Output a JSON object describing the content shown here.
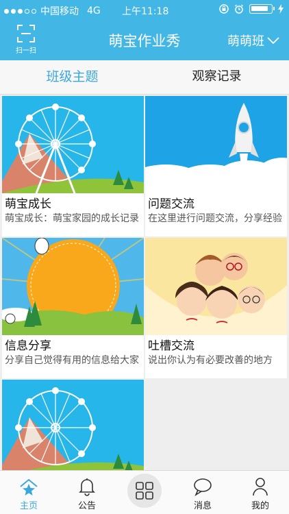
{
  "status_bar": {
    "carrier": "中国移动",
    "network": "4G",
    "time": "上午11:18"
  },
  "header": {
    "scan_label": "扫一扫",
    "title": "萌宝作业秀",
    "class_name": "萌萌班"
  },
  "tabs": [
    {
      "label": "班级主题",
      "active": true
    },
    {
      "label": "观察记录",
      "active": false
    }
  ],
  "topics": [
    {
      "title": "萌宝成长",
      "desc": "萌宝成长：萌宝家园的成长记录",
      "image": "ferris-wheel"
    },
    {
      "title": "问题交流",
      "desc": "在这里进行问题交流，分享经验",
      "image": "rocket"
    },
    {
      "title": "信息分享",
      "desc": "分享自己觉得有用的信息给大家",
      "image": "sun"
    },
    {
      "title": "吐槽交流",
      "desc": "说出你认为有必要改善的地方",
      "image": "family"
    },
    {
      "title": "",
      "desc": "",
      "image": "ferris-wheel"
    }
  ],
  "bottom_nav": [
    {
      "label": "主页",
      "icon": "home-star-icon",
      "active": true
    },
    {
      "label": "公告",
      "icon": "bell-icon",
      "active": false
    },
    {
      "label": "",
      "icon": "grid-icon",
      "active": false
    },
    {
      "label": "消息",
      "icon": "chat-bubble-icon",
      "active": false
    },
    {
      "label": "我的",
      "icon": "person-icon",
      "active": false
    }
  ],
  "colors": {
    "brand": "#42b7e6",
    "active_tab": "#3aa8dc"
  }
}
